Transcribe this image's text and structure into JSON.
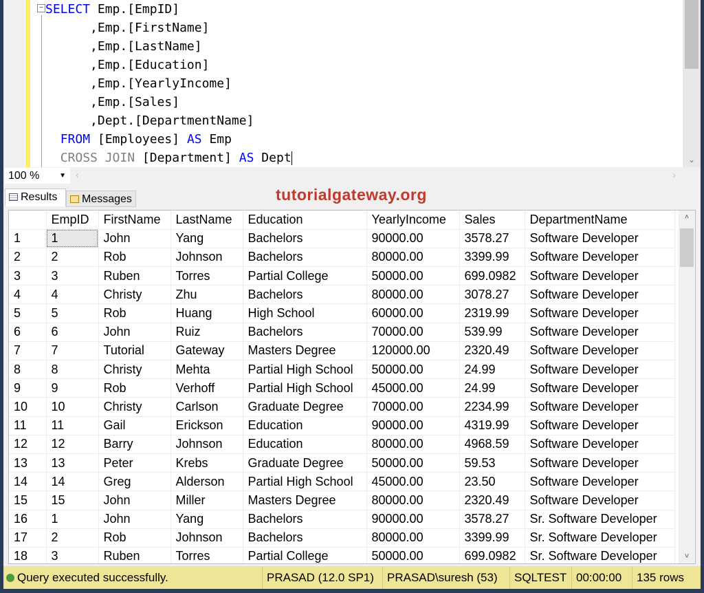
{
  "editor": {
    "lines": [
      [
        {
          "t": "SELECT",
          "c": "kw"
        },
        {
          "t": " Emp.[EmpID]"
        }
      ],
      [
        {
          "t": "      ,Emp.[FirstName]"
        }
      ],
      [
        {
          "t": "      ,Emp.[LastName]"
        }
      ],
      [
        {
          "t": "      ,Emp.[Education]"
        }
      ],
      [
        {
          "t": "      ,Emp.[YearlyIncome]"
        }
      ],
      [
        {
          "t": "      ,Emp.[Sales]"
        }
      ],
      [
        {
          "t": "      ,Dept.[DepartmentName]"
        }
      ],
      [
        {
          "t": "  "
        },
        {
          "t": "FROM",
          "c": "kw"
        },
        {
          "t": " [Employees] "
        },
        {
          "t": "AS",
          "c": "kw"
        },
        {
          "t": " Emp"
        }
      ],
      [
        {
          "t": "  "
        },
        {
          "t": "CROSS JOIN",
          "c": "gr"
        },
        {
          "t": " [Department] "
        },
        {
          "t": "AS",
          "c": "kw"
        },
        {
          "t": " Dept"
        }
      ]
    ]
  },
  "zoom": {
    "value": "100 %"
  },
  "tabs": {
    "results": "Results",
    "messages": "Messages"
  },
  "watermark": "tutorialgateway.org",
  "grid": {
    "columns": [
      "",
      "EmpID",
      "FirstName",
      "LastName",
      "Education",
      "YearlyIncome",
      "Sales",
      "DepartmentName"
    ],
    "rows": [
      [
        "1",
        "1",
        "John",
        "Yang",
        "Bachelors",
        "90000.00",
        "3578.27",
        "Software Developer"
      ],
      [
        "2",
        "2",
        "Rob",
        "Johnson",
        "Bachelors",
        "80000.00",
        "3399.99",
        "Software Developer"
      ],
      [
        "3",
        "3",
        "Ruben",
        "Torres",
        "Partial College",
        "50000.00",
        "699.0982",
        "Software Developer"
      ],
      [
        "4",
        "4",
        "Christy",
        "Zhu",
        "Bachelors",
        "80000.00",
        "3078.27",
        "Software Developer"
      ],
      [
        "5",
        "5",
        "Rob",
        "Huang",
        "High School",
        "60000.00",
        "2319.99",
        "Software Developer"
      ],
      [
        "6",
        "6",
        "John",
        "Ruiz",
        "Bachelors",
        "70000.00",
        "539.99",
        "Software Developer"
      ],
      [
        "7",
        "7",
        "Tutorial",
        "Gateway",
        "Masters Degree",
        "120000.00",
        "2320.49",
        "Software Developer"
      ],
      [
        "8",
        "8",
        "Christy",
        "Mehta",
        "Partial High School",
        "50000.00",
        "24.99",
        "Software Developer"
      ],
      [
        "9",
        "9",
        "Rob",
        "Verhoff",
        "Partial High School",
        "45000.00",
        "24.99",
        "Software Developer"
      ],
      [
        "10",
        "10",
        "Christy",
        "Carlson",
        "Graduate Degree",
        "70000.00",
        "2234.99",
        "Software Developer"
      ],
      [
        "11",
        "11",
        "Gail",
        "Erickson",
        "Education",
        "90000.00",
        "4319.99",
        "Software Developer"
      ],
      [
        "12",
        "12",
        "Barry",
        "Johnson",
        "Education",
        "80000.00",
        "4968.59",
        "Software Developer"
      ],
      [
        "13",
        "13",
        "Peter",
        "Krebs",
        "Graduate Degree",
        "50000.00",
        "59.53",
        "Software Developer"
      ],
      [
        "14",
        "14",
        "Greg",
        "Alderson",
        "Partial High School",
        "45000.00",
        "23.50",
        "Software Developer"
      ],
      [
        "15",
        "15",
        "John",
        "Miller",
        "Masters Degree",
        "80000.00",
        "2320.49",
        "Software Developer"
      ],
      [
        "16",
        "1",
        "John",
        "Yang",
        "Bachelors",
        "90000.00",
        "3578.27",
        "Sr. Software Developer"
      ],
      [
        "17",
        "2",
        "Rob",
        "Johnson",
        "Bachelors",
        "80000.00",
        "3399.99",
        "Sr. Software Developer"
      ],
      [
        "18",
        "3",
        "Ruben",
        "Torres",
        "Partial College",
        "50000.00",
        "699.0982",
        "Sr. Software Developer"
      ]
    ]
  },
  "status": {
    "message": "Query executed successfully.",
    "server": "PRASAD (12.0 SP1)",
    "user": "PRASAD\\suresh (53)",
    "database": "SQLTEST",
    "elapsed": "00:00:00",
    "rows": "135 rows"
  }
}
